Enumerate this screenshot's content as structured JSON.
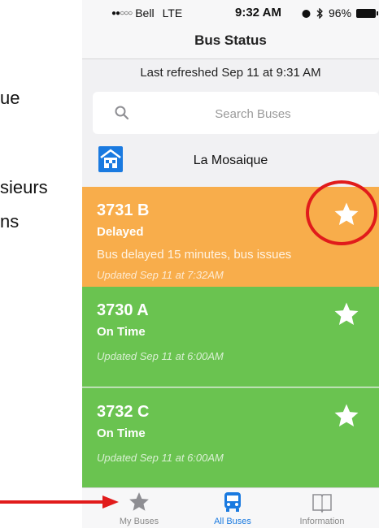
{
  "slide_fragments": [
    "ue",
    "sieurs",
    "ns"
  ],
  "status_bar": {
    "carrier": "Bell",
    "network": "LTE",
    "time": "9:32 AM",
    "battery": "96%"
  },
  "nav": {
    "title": "Bus Status"
  },
  "refresh_text": "Last refreshed Sep 11 at 9:31 AM",
  "search": {
    "placeholder": "Search Buses"
  },
  "school": {
    "name": "La Mosaique"
  },
  "buses": [
    {
      "number": "3731 B",
      "status": "Delayed",
      "message": "Bus delayed 15 minutes, bus issues",
      "updated": "Updated Sep 11 at 7:32AM"
    },
    {
      "number": "3730 A",
      "status": "On Time",
      "updated": "Updated Sep 11 at 6:00AM"
    },
    {
      "number": "3732 C",
      "status": "On Time",
      "updated": "Updated Sep 11 at 6:00AM"
    }
  ],
  "tabs": [
    {
      "label": "My Buses",
      "icon": "star-icon"
    },
    {
      "label": "All Buses",
      "icon": "bus-icon"
    },
    {
      "label": "Information",
      "icon": "book-icon"
    }
  ],
  "colors": {
    "delayed": "#f8ad4b",
    "on_time": "#6ac350",
    "accent": "#1a7ae0",
    "annotation": "#e11b1b"
  }
}
